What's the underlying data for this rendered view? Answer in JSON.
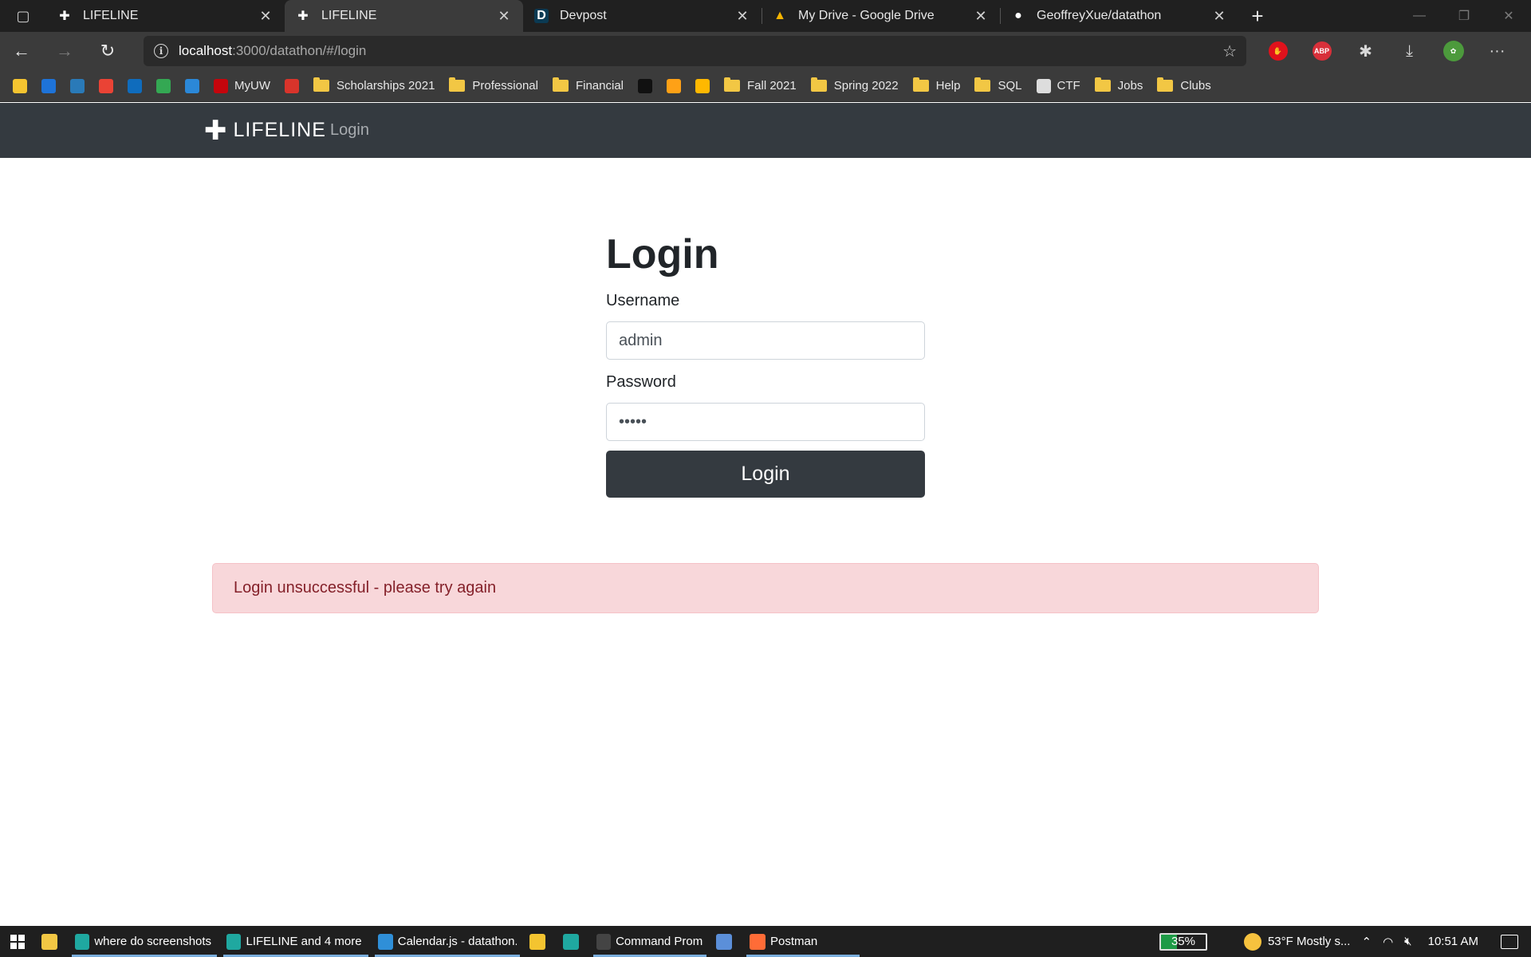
{
  "browser": {
    "tabs": [
      {
        "title": "LIFELINE",
        "icon": "plus-icon",
        "active": false
      },
      {
        "title": "LIFELINE",
        "icon": "plus-icon",
        "active": true
      },
      {
        "title": "Devpost",
        "icon": "devpost-icon",
        "active": false
      },
      {
        "title": "My Drive - Google Drive",
        "icon": "google-drive-icon",
        "active": false
      },
      {
        "title": "GeoffreyXue/datathon",
        "icon": "github-icon",
        "active": false
      }
    ],
    "address": {
      "host": "localhost",
      "path": ":3000/datathon/#/login"
    },
    "extensions": [
      "stop-icon",
      "adblock-icon",
      "puzzle-icon",
      "download-icon",
      "profile-avatar-icon",
      "more-icon"
    ],
    "adblock_label": "ABP",
    "bookmarks": [
      {
        "label": "",
        "icon": "bookmark-app-icon",
        "color": "#f4c430"
      },
      {
        "label": "",
        "icon": "bookmark-app-icon",
        "color": "#1e73d8"
      },
      {
        "label": "",
        "icon": "bookmark-app-icon",
        "color": "#2a7ab8"
      },
      {
        "label": "",
        "icon": "gmail-icon",
        "color": "#ea4335"
      },
      {
        "label": "",
        "icon": "outlook-icon",
        "color": "#0f6cbd"
      },
      {
        "label": "",
        "icon": "google-drive-icon",
        "color": "#34a853"
      },
      {
        "label": "",
        "icon": "onedrive-icon",
        "color": "#2b88d8"
      },
      {
        "label": "MyUW",
        "icon": "uw-icon",
        "color": "#c5050c"
      },
      {
        "label": "",
        "icon": "bookmark-app-icon",
        "color": "#d9342b"
      },
      {
        "label": "Scholarships 2021",
        "icon": "folder-icon",
        "color": "#f2c744"
      },
      {
        "label": "Professional",
        "icon": "folder-icon",
        "color": "#f2c744"
      },
      {
        "label": "Financial",
        "icon": "folder-icon",
        "color": "#f2c744"
      },
      {
        "label": "",
        "icon": "bookmark-app-icon",
        "color": "#111111"
      },
      {
        "label": "",
        "icon": "bookmark-app-icon",
        "color": "#ffa116"
      },
      {
        "label": "",
        "icon": "bookmark-app-icon",
        "color": "#ffb800"
      },
      {
        "label": "Fall 2021",
        "icon": "folder-icon",
        "color": "#f2c744"
      },
      {
        "label": "Spring 2022",
        "icon": "folder-icon",
        "color": "#f2c744"
      },
      {
        "label": "Help",
        "icon": "folder-icon",
        "color": "#f2c744"
      },
      {
        "label": "SQL",
        "icon": "folder-icon",
        "color": "#f2c744"
      },
      {
        "label": "CTF",
        "icon": "book-icon",
        "color": "#dddddd"
      },
      {
        "label": "Jobs",
        "icon": "folder-icon",
        "color": "#f2c744"
      },
      {
        "label": "Clubs",
        "icon": "folder-icon",
        "color": "#f2c744"
      }
    ]
  },
  "app": {
    "brand": "LIFELINE",
    "brand_icon": "plus-icon",
    "nav_login": "Login",
    "form": {
      "title": "Login",
      "username_label": "Username",
      "username_value": "admin",
      "password_label": "Password",
      "password_value": "•••••",
      "submit_label": "Login"
    },
    "alert": "Login unsuccessful - please try again",
    "colors": {
      "navbar": "#343a40",
      "alert_bg": "#f8d7da",
      "alert_text": "#842029"
    }
  },
  "taskbar": {
    "items": [
      {
        "label": "",
        "icon": "file-explorer-icon",
        "color": "#f2c744",
        "running": false
      },
      {
        "label": "where do screenshots ...",
        "icon": "edge-icon",
        "color": "#1fa8a0",
        "running": true
      },
      {
        "label": "LIFELINE and 4 more ...",
        "icon": "edge-icon",
        "color": "#1fa8a0",
        "running": true
      },
      {
        "label": "Calendar.js - datathon...",
        "icon": "vscode-icon",
        "color": "#2f8fd8",
        "running": true
      },
      {
        "label": "",
        "icon": "sticky-notes-icon",
        "color": "#f4c430",
        "running": false
      },
      {
        "label": "",
        "icon": "edge-icon",
        "color": "#1fa8a0",
        "running": false
      },
      {
        "label": "Command Prompt",
        "icon": "terminal-icon",
        "color": "#444444",
        "running": true
      },
      {
        "label": "",
        "icon": "r-icon",
        "color": "#5b8fd9",
        "running": false
      },
      {
        "label": "Postman",
        "icon": "postman-icon",
        "color": "#ff6c37",
        "running": true
      }
    ],
    "battery": "35%",
    "battery_level": 0.35,
    "weather": "53°F  Mostly s...",
    "time": "10:51 AM"
  }
}
